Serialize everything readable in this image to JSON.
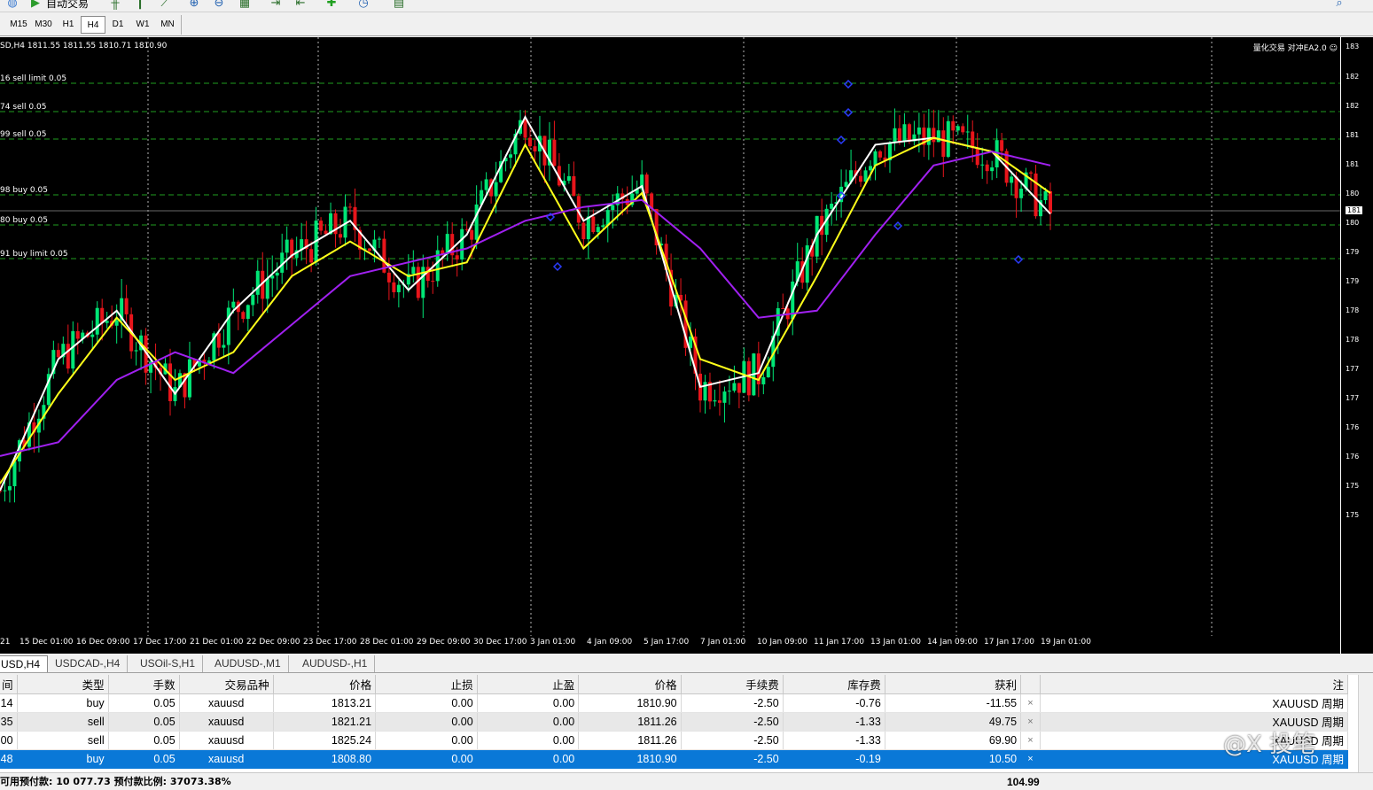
{
  "toolbar": {
    "autotrade_label": "自动交易",
    "icons": [
      "globe-icon",
      "autotrade-icon",
      "bar-chart-icon",
      "candles-icon",
      "line-chart-icon",
      "zoom-in-icon",
      "zoom-out-icon",
      "tile-icon",
      "scroll-icon",
      "shift-icon",
      "indicators-icon",
      "periods-icon",
      "templates-icon",
      "search-icon"
    ]
  },
  "timeframes": [
    {
      "label": "M15",
      "active": false
    },
    {
      "label": "M30",
      "active": false
    },
    {
      "label": "H1",
      "active": false
    },
    {
      "label": "H4",
      "active": true
    },
    {
      "label": "D1",
      "active": false
    },
    {
      "label": "W1",
      "active": false
    },
    {
      "label": "MN",
      "active": false
    }
  ],
  "chart": {
    "ohlc_header": "SD,H4  1811.55 1811.55 1810.71 1810.90",
    "ea_label": "量化交易 对冲EA2.0 ☺",
    "current_price_label": "181",
    "orders": [
      {
        "label": "16 sell limit 0.05"
      },
      {
        "label": "74 sell 0.05"
      },
      {
        "label": "99 sell 0.05"
      },
      {
        "label": "98 buy 0.05"
      },
      {
        "label": "80 buy 0.05"
      },
      {
        "label": "91 buy limit 0.05"
      }
    ],
    "time_labels": [
      "21",
      "15 Dec 01:00",
      "16 Dec 09:00",
      "17 Dec 17:00",
      "21 Dec 01:00",
      "22 Dec 09:00",
      "23 Dec 17:00",
      "28 Dec 01:00",
      "29 Dec 09:00",
      "30 Dec 17:00",
      "3 Jan 01:00",
      "4 Jan 09:00",
      "5 Jan 17:00",
      "7 Jan 01:00",
      "10 Jan 09:00",
      "11 Jan 17:00",
      "13 Jan 01:00",
      "14 Jan 09:00",
      "17 Jan 17:00",
      "19 Jan 01:00"
    ],
    "price_labels": [
      "183",
      "182",
      "182",
      "181",
      "181",
      "180",
      "180",
      "179",
      "179",
      "178",
      "178",
      "177",
      "177",
      "176",
      "176",
      "175",
      "175"
    ],
    "colors": {
      "background": "#000000",
      "bull": "#00e676",
      "bear": "#e8151b",
      "ma_fast": "#ffffff",
      "ma_mid": "#ffff1a",
      "ma_slow": "#a020f0",
      "order_line": "#1f9e1f",
      "marker": "#2a3cff"
    }
  },
  "chart_data": {
    "type": "line",
    "title": "SD,H4",
    "ohlc_last": {
      "open": 1811.55,
      "high": 1811.55,
      "low": 1810.71,
      "close": 1810.9
    },
    "x": [
      "15 Dec 01:00",
      "16 Dec 09:00",
      "17 Dec 17:00",
      "21 Dec 01:00",
      "22 Dec 09:00",
      "23 Dec 17:00",
      "28 Dec 01:00",
      "29 Dec 09:00",
      "30 Dec 17:00",
      "3 Jan 01:00",
      "4 Jan 09:00",
      "5 Jan 17:00",
      "7 Jan 01:00",
      "10 Jan 09:00",
      "11 Jan 17:00",
      "13 Jan 01:00",
      "14 Jan 09:00",
      "17 Jan 17:00",
      "19 Jan 01:00"
    ],
    "series": [
      {
        "values": [
          1771,
          1790,
          1797,
          1785,
          1797,
          1805,
          1810,
          1800,
          1808,
          1825,
          1810,
          1815,
          1786,
          1788,
          1808,
          1821,
          1822,
          1820,
          1811
        ]
      },
      {
        "values": [
          1772,
          1785,
          1796,
          1787,
          1791,
          1802,
          1807,
          1802,
          1804,
          1821,
          1806,
          1814,
          1790,
          1787,
          1802,
          1818,
          1822,
          1820,
          1814
        ]
      },
      {
        "values": [
          1776,
          1778,
          1787,
          1791,
          1788,
          1795,
          1802,
          1804,
          1806,
          1810,
          1812,
          1813,
          1806,
          1796,
          1797,
          1808,
          1818,
          1820,
          1818
        ]
      }
    ],
    "ylim": [
      1750,
      1835
    ]
  },
  "chart_tabs": [
    {
      "label": "USD,H4",
      "active": true
    },
    {
      "label": "USDCAD-,H4",
      "active": false
    },
    {
      "label": "USOil-S,H1",
      "active": false
    },
    {
      "label": "AUDUSD-,M1",
      "active": false
    },
    {
      "label": "AUDUSD-,H1",
      "active": false
    }
  ],
  "table": {
    "headers": [
      "间",
      "类型",
      "手数",
      "交易品种",
      "价格",
      "止损",
      "止盈",
      "价格",
      "手续费",
      "库存费",
      "获利",
      "",
      "注"
    ],
    "rows": [
      {
        "time": ":14",
        "type": "buy",
        "lots": "0.05",
        "symbol": "xauusd",
        "price": "1813.21",
        "sl": "0.00",
        "tp": "0.00",
        "current": "1810.90",
        "commission": "-2.50",
        "swap": "-0.76",
        "profit": "-11.55",
        "close": "×",
        "comment": "XAUUSD 周期"
      },
      {
        "time": ":35",
        "type": "sell",
        "lots": "0.05",
        "symbol": "xauusd",
        "price": "1821.21",
        "sl": "0.00",
        "tp": "0.00",
        "current": "1811.26",
        "commission": "-2.50",
        "swap": "-1.33",
        "profit": "49.75",
        "close": "×",
        "comment": "XAUUSD 周期"
      },
      {
        "time": ":00",
        "type": "sell",
        "lots": "0.05",
        "symbol": "xauusd",
        "price": "1825.24",
        "sl": "0.00",
        "tp": "0.00",
        "current": "1811.26",
        "commission": "-2.50",
        "swap": "-1.33",
        "profit": "69.90",
        "close": "×",
        "comment": "XAUUSD 周期"
      },
      {
        "time": ":48",
        "type": "buy",
        "lots": "0.05",
        "symbol": "xauusd",
        "price": "1808.80",
        "sl": "0.00",
        "tp": "0.00",
        "current": "1810.90",
        "commission": "-2.50",
        "swap": "-0.19",
        "profit": "10.50",
        "close": "×",
        "comment": "XAUUSD 周期"
      }
    ],
    "summary": "可用预付款: 10 077.73  预付款比例: 37073.38%",
    "total_profit": "104.99"
  },
  "watermark": "@X 投笔"
}
